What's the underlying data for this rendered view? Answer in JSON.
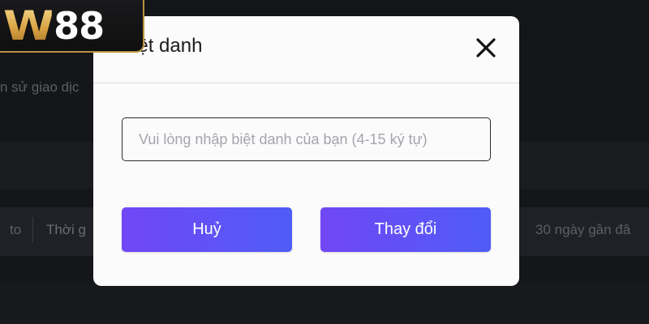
{
  "logo": {
    "mark": "W",
    "number": "88"
  },
  "background": {
    "history_text": "n sử giao dịc",
    "filter_to": "to",
    "filter_time": "Thời g",
    "filter_range": "30 ngày gần đâ"
  },
  "modal": {
    "title": "Biệt danh",
    "close_icon": "close-icon",
    "input_placeholder": "Vui lòng nhập biệt danh của bạn (4-15 ký tự)",
    "input_value": "",
    "cancel_label": "Huỷ",
    "change_label": "Thay đổi"
  },
  "colors": {
    "button_gradient_start": "#7147f5",
    "button_gradient_end": "#4f5cf6",
    "logo_gold": "#e3b553",
    "overlay_bg": "#151619"
  }
}
